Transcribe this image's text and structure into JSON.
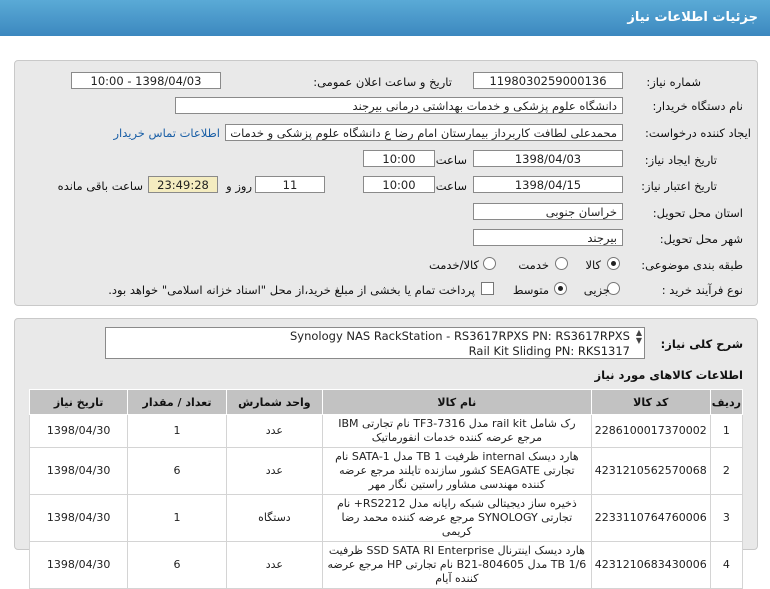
{
  "page": {
    "title": "جزئیات اطلاعات نیاز"
  },
  "form": {
    "need_number_label": "شماره نیاز:",
    "need_number": "1198030259000136",
    "announce_label": "تاریخ و ساعت اعلان عمومی:",
    "announce_value": "1398/04/03 - 10:00",
    "buyer_label": "نام دستگاه خریدار:",
    "buyer": "دانشگاه علوم پزشکی و خدمات بهداشتی درمانی بیرجند",
    "creator_label": "ایجاد کننده درخواست:",
    "creator": "محمدعلی لطافت کاربرداز بیمارستان امام رضا ع دانشگاه علوم پزشکی و خدمات",
    "contact_link": "اطلاعات تماس خریدار",
    "created_date_label": "تاریخ ایجاد نیاز:",
    "created_date": "1398/04/03",
    "time_label": "ساعت",
    "created_time": "10:00",
    "validity_label": "تاریخ اعتبار نیاز:",
    "validity_date": "1398/04/15",
    "validity_time": "10:00",
    "days_value": "11",
    "days_and_label": "روز و",
    "remaining_time": "23:49:28",
    "remaining_label": "ساعت باقی مانده",
    "province_label": "استان محل تحویل:",
    "province": "خراسان جنوبی",
    "city_label": "شهر محل تحویل:",
    "city": "بیرجند",
    "category_label": "طبقه بندی موضوعی:",
    "category_options": [
      "کالا",
      "خدمت",
      "کالا/خدمت"
    ],
    "category_selected": "کالا",
    "process_label": "نوع فرآیند خرید :",
    "process_options": [
      "جزیی",
      "متوسط"
    ],
    "process_selected": "متوسط",
    "payment_note": "پرداخت تمام یا بخشی از مبلغ خرید،از محل \"اسناد خزانه اسلامی\" خواهد بود."
  },
  "description": {
    "label": "شرح کلی نیاز:",
    "line1": "Synology NAS RackStation - RS3617RPXS  PN: RS3617RPXS",
    "line2": "Rail Kit Sliding PN: RKS1317",
    "goods_info_title": "اطلاعات کالاهای مورد نیاز"
  },
  "table": {
    "headers": [
      "ردیف",
      "کد کالا",
      "نام کالا",
      "واحد شمارش",
      "تعداد / مقدار",
      "تاریخ نیاز"
    ],
    "rows": [
      {
        "row": "1",
        "code": "2286100017370002",
        "name": "رک شامل rail kit مدل TF3-7316 نام تجارتی IBM مرجع عرضه کننده خدمات انفورماتیک",
        "unit": "عدد",
        "qty": "1",
        "date": "1398/04/30"
      },
      {
        "row": "2",
        "code": "4231210562570068",
        "name": "هارد دیسک internal ظرفیت 1 TB مدل SATA-1 نام تجارتی SEAGATE کشور سازنده تایلند مرجع عرضه کننده مهندسی مشاور راستین نگار مهر",
        "unit": "عدد",
        "qty": "6",
        "date": "1398/04/30"
      },
      {
        "row": "3",
        "code": "2233110764760006",
        "name": "ذخیره ساز دیجیتالی شبکه رایانه مدل RS2212+ نام تجارتی SYNOLOGY مرجع عرضه کننده محمد رضا کریمی",
        "unit": "دستگاه",
        "qty": "1",
        "date": "1398/04/30"
      },
      {
        "row": "4",
        "code": "4231210683430006",
        "name": "هارد دیسک اینترنال SSD SATA RI Enterprise ظرفیت 1/6 TB مدل B21-804605 نام تجارتی HP مرجع عرضه کننده آیام",
        "unit": "عدد",
        "qty": "6",
        "date": "1398/04/30"
      }
    ]
  }
}
